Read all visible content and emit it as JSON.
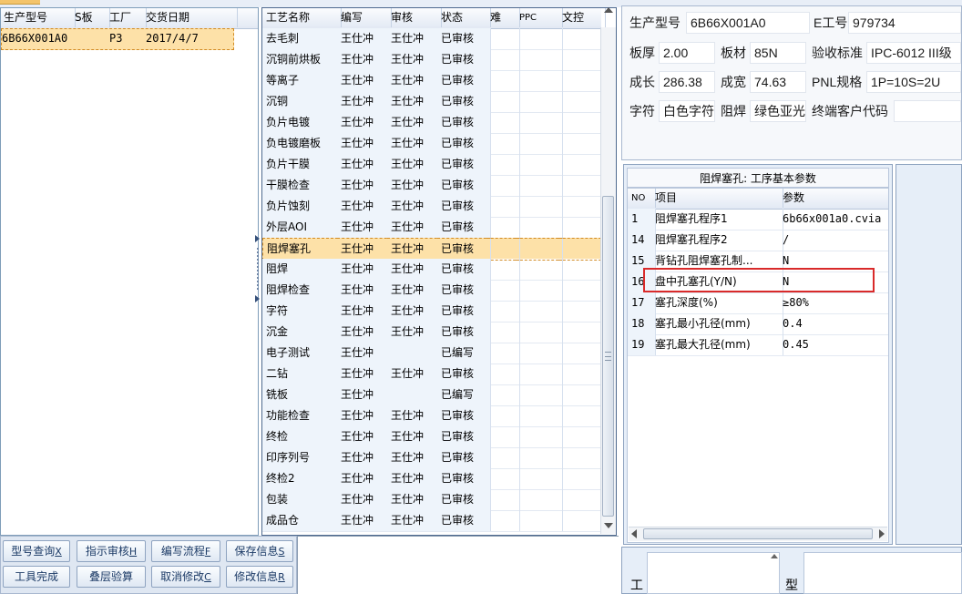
{
  "left_table": {
    "headers": [
      "生产型号",
      "S板",
      "工厂",
      "交货日期"
    ],
    "rows": [
      {
        "model": "6B66X001A0",
        "s_board": "",
        "factory": "P3",
        "delivery_date": "2017/4/7"
      }
    ]
  },
  "process_table": {
    "headers": [
      "工艺名称",
      "编写",
      "审核",
      "状态",
      "难",
      "PPC",
      "文控"
    ],
    "selected_index": 10,
    "rows": [
      {
        "name": "去毛刺",
        "writer": "王仕冲",
        "reviewer": "王仕冲",
        "status": "已审核"
      },
      {
        "name": "沉铜前烘板",
        "writer": "王仕冲",
        "reviewer": "王仕冲",
        "status": "已审核"
      },
      {
        "name": "等离子",
        "writer": "王仕冲",
        "reviewer": "王仕冲",
        "status": "已审核"
      },
      {
        "name": "沉铜",
        "writer": "王仕冲",
        "reviewer": "王仕冲",
        "status": "已审核"
      },
      {
        "name": "负片电镀",
        "writer": "王仕冲",
        "reviewer": "王仕冲",
        "status": "已审核"
      },
      {
        "name": "负电镀磨板",
        "writer": "王仕冲",
        "reviewer": "王仕冲",
        "status": "已审核"
      },
      {
        "name": "负片干膜",
        "writer": "王仕冲",
        "reviewer": "王仕冲",
        "status": "已审核"
      },
      {
        "name": "干膜检查",
        "writer": "王仕冲",
        "reviewer": "王仕冲",
        "status": "已审核"
      },
      {
        "name": "负片蚀刻",
        "writer": "王仕冲",
        "reviewer": "王仕冲",
        "status": "已审核"
      },
      {
        "name": "外层AOI",
        "writer": "王仕冲",
        "reviewer": "王仕冲",
        "status": "已审核"
      },
      {
        "name": "阻焊塞孔",
        "writer": "王仕冲",
        "reviewer": "王仕冲",
        "status": "已审核"
      },
      {
        "name": "阻焊",
        "writer": "王仕冲",
        "reviewer": "王仕冲",
        "status": "已审核"
      },
      {
        "name": "阻焊检查",
        "writer": "王仕冲",
        "reviewer": "王仕冲",
        "status": "已审核"
      },
      {
        "name": "字符",
        "writer": "王仕冲",
        "reviewer": "王仕冲",
        "status": "已审核"
      },
      {
        "name": "沉金",
        "writer": "王仕冲",
        "reviewer": "王仕冲",
        "status": "已审核"
      },
      {
        "name": "电子测试",
        "writer": "王仕冲",
        "reviewer": "",
        "status": "已编写"
      },
      {
        "name": "二钻",
        "writer": "王仕冲",
        "reviewer": "王仕冲",
        "status": "已审核"
      },
      {
        "name": "铣板",
        "writer": "王仕冲",
        "reviewer": "",
        "status": "已编写"
      },
      {
        "name": "功能检查",
        "writer": "王仕冲",
        "reviewer": "王仕冲",
        "status": "已审核"
      },
      {
        "name": "终检",
        "writer": "王仕冲",
        "reviewer": "王仕冲",
        "status": "已审核"
      },
      {
        "name": "印序列号",
        "writer": "王仕冲",
        "reviewer": "王仕冲",
        "status": "已审核"
      },
      {
        "name": "终检2",
        "writer": "王仕冲",
        "reviewer": "王仕冲",
        "status": "已审核"
      },
      {
        "name": "包装",
        "writer": "王仕冲",
        "reviewer": "王仕冲",
        "status": "已审核"
      },
      {
        "name": "成品仓",
        "writer": "王仕冲",
        "reviewer": "王仕冲",
        "status": "已审核"
      }
    ]
  },
  "buttons": [
    {
      "label": "型号查询",
      "key": "X"
    },
    {
      "label": "指示审核",
      "key": "H"
    },
    {
      "label": "编写流程",
      "key": "F"
    },
    {
      "label": "保存信息",
      "key": "S"
    },
    {
      "label": "工具完成",
      "key": ""
    },
    {
      "label": "叠层验算",
      "key": ""
    },
    {
      "label": "取消修改",
      "key": "C"
    },
    {
      "label": "修改信息",
      "key": "R"
    }
  ],
  "info": {
    "model_label": "生产型号",
    "model_value": "6B66X001A0",
    "eno_label": "E工号",
    "eno_value": "979734",
    "thickness_label": "板厚",
    "thickness_value": "2.00",
    "material_label": "板材",
    "material_value": "85N",
    "standard_label": "验收标准",
    "standard_value": "IPC-6012 III级",
    "length_label": "成长",
    "length_value": "286.38",
    "width_label": "成宽",
    "width_value": "74.63",
    "pnl_label": "PNL规格",
    "pnl_value": "1P=10S=2U",
    "char_label": "字符",
    "char_value": "白色字符",
    "mask_label": "阻焊",
    "mask_value": "绿色亚光",
    "customer_label": "终端客户代码",
    "customer_value": ""
  },
  "params": {
    "title": "阻焊塞孔: 工序基本参数",
    "headers": [
      "NO",
      "项目",
      "参数"
    ],
    "rows": [
      {
        "no": "1",
        "item": "阻焊塞孔程序1",
        "value": "6b66x001a0.cvia"
      },
      {
        "no": "14",
        "item": "阻焊塞孔程序2",
        "value": "/"
      },
      {
        "no": "15",
        "item": "背钻孔阻焊塞孔制...",
        "value": "N"
      },
      {
        "no": "16",
        "item": "盘中孔塞孔(Y/N)",
        "value": "N"
      },
      {
        "no": "17",
        "item": "塞孔深度(%)",
        "value": "≥80%"
      },
      {
        "no": "18",
        "item": "塞孔最小孔径(mm)",
        "value": "0.4"
      },
      {
        "no": "19",
        "item": "塞孔最大孔径(mm)",
        "value": "0.45"
      }
    ],
    "highlighted_no": "16"
  },
  "bottom": {
    "label_left": "工",
    "label_right": "型"
  },
  "colors": {
    "selection": "#fde1a8",
    "highlight_box": "#d92a2a",
    "header_bg": "#e2e9f4"
  }
}
